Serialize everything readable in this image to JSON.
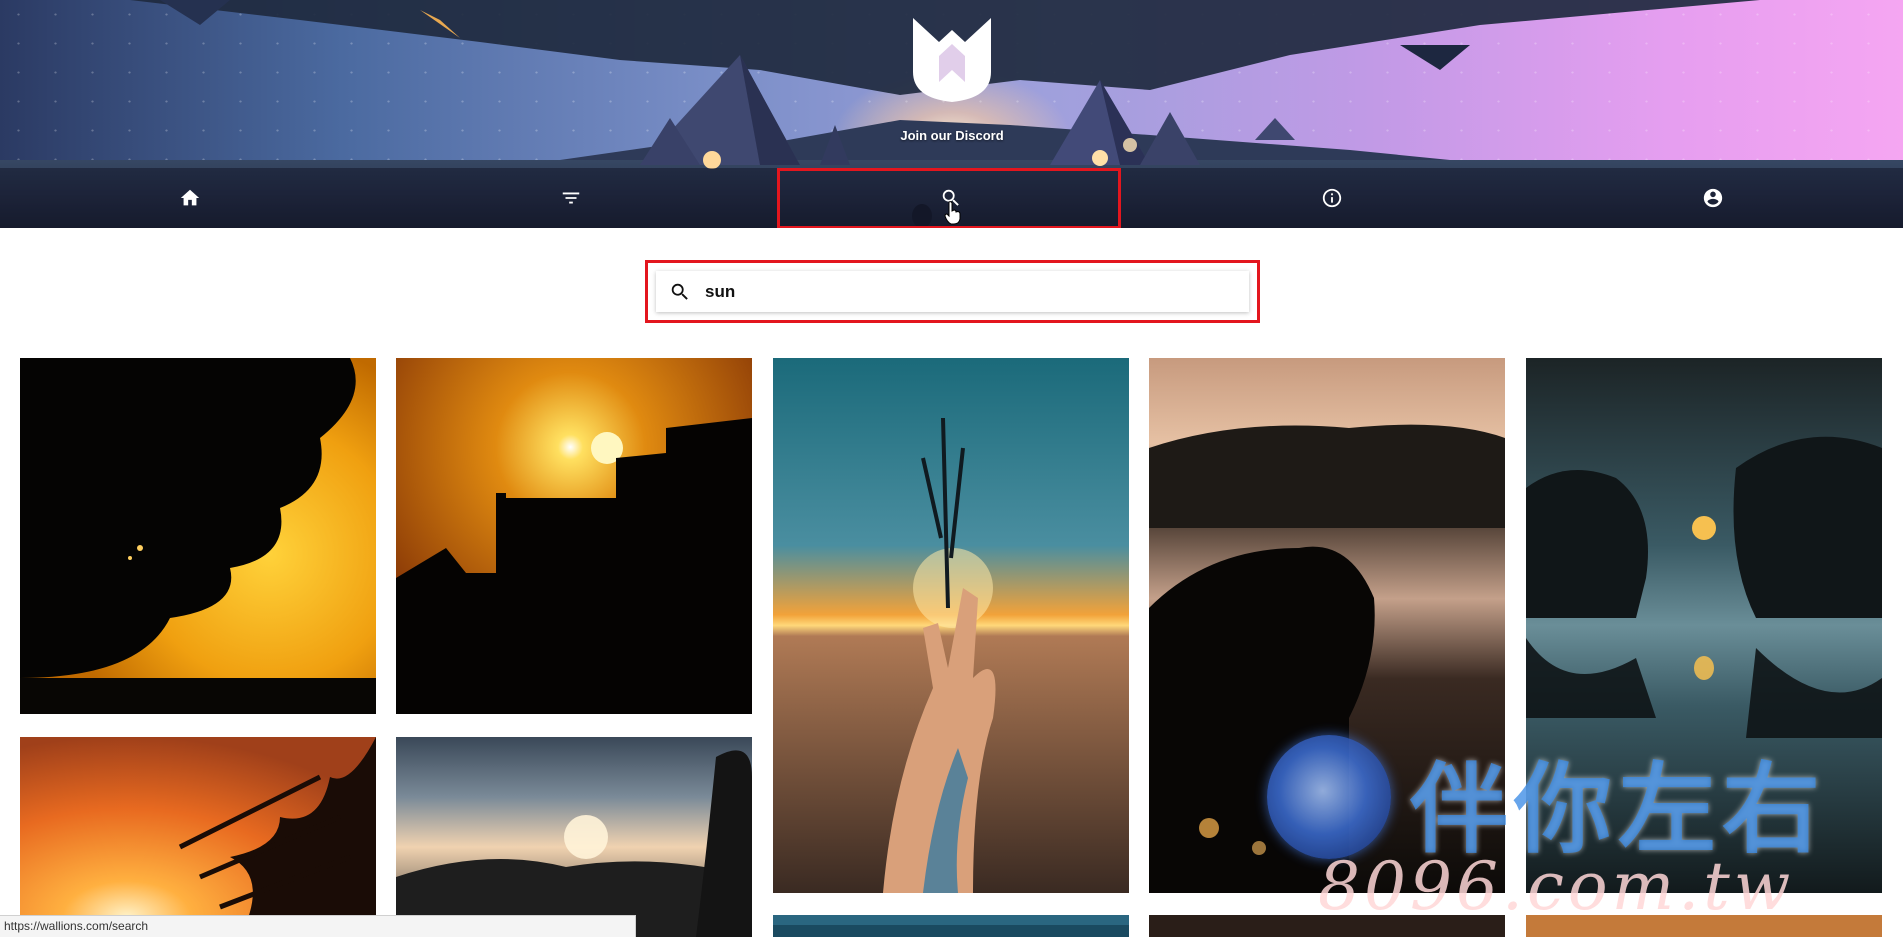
{
  "header": {
    "discord_link": "Join our Discord",
    "colors": {
      "highlight": "#e3161e"
    }
  },
  "nav": {
    "items": [
      {
        "name": "home",
        "icon": "home-icon"
      },
      {
        "name": "filter",
        "icon": "filter-icon"
      },
      {
        "name": "search",
        "icon": "search-icon",
        "active": true
      },
      {
        "name": "info",
        "icon": "info-icon"
      },
      {
        "name": "account",
        "icon": "account-circle-icon"
      }
    ]
  },
  "search": {
    "value": "sun",
    "placeholder": ""
  },
  "gallery": {
    "images": [
      {
        "subject": "tree silhouette at sunset"
      },
      {
        "subject": "city rooftop silhouette with sun"
      },
      {
        "subject": "hand holding sun on beach"
      },
      {
        "subject": "woman by lake at dusk"
      },
      {
        "subject": "trees reflected with moon"
      },
      {
        "subject": "palm leaves at sunset"
      },
      {
        "subject": "sun over hills and clouds"
      }
    ]
  },
  "watermark": {
    "text": "伴你左右",
    "url": "8096.com.tw"
  },
  "status_bar": {
    "url": "https://wallions.com/search"
  }
}
